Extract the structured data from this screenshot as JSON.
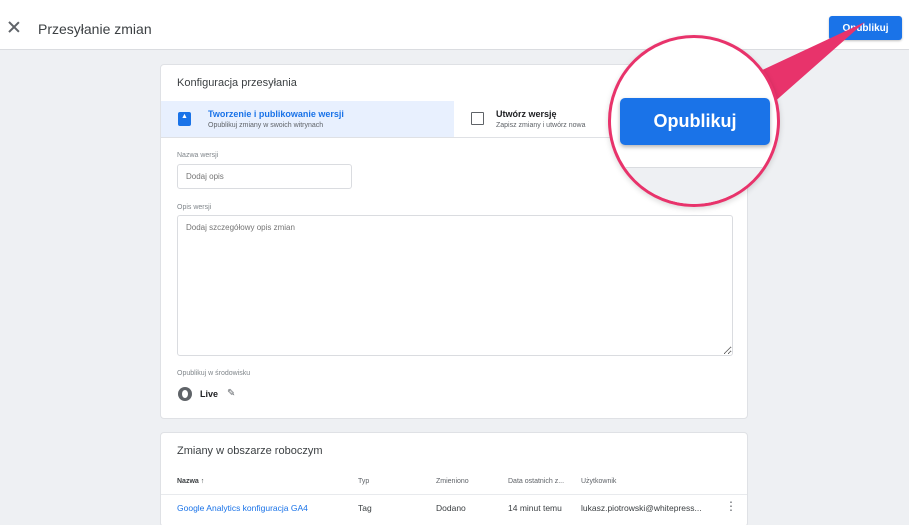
{
  "header": {
    "title": "Przesyłanie zmian",
    "publish_label": "Opublikuj"
  },
  "config": {
    "title": "Konfiguracja przesyłania",
    "option_publish": {
      "title": "Tworzenie i publikowanie wersji",
      "subtitle": "Opublikuj zmiany w swoich witrynach"
    },
    "option_version": {
      "title": "Utwórz wersję",
      "subtitle": "Zapisz zmiany i utwórz nowa"
    },
    "version_name": {
      "label": "Nazwa wersji",
      "placeholder": "Dodaj opis"
    },
    "version_description": {
      "label": "Opis wersji",
      "placeholder": "Dodaj szczegółowy opis zmian"
    },
    "environment": {
      "label": "Opublikuj w środowisku",
      "value": "Live"
    }
  },
  "changes": {
    "title": "Zmiany w obszarze roboczym",
    "columns": [
      "Nazwa",
      "Typ",
      "Zmieniono",
      "Data ostatnich z...",
      "Użytkownik"
    ],
    "sort_indicator": "↑",
    "rows": [
      {
        "name": "Google Analytics konfiguracja GA4",
        "type": "Tag",
        "change": "Dodano",
        "date": "14 minut temu",
        "user": "lukasz.piotrowski@whitepress..."
      }
    ]
  },
  "callout": {
    "button_label": "Opublikuj"
  },
  "colors": {
    "accent": "#1a73e8",
    "callout": "#e8336b"
  },
  "icons": [
    "close-icon",
    "publish-version-icon",
    "create-version-icon",
    "globe-icon",
    "pencil-icon",
    "sort-arrow-icon",
    "more-vert-icon"
  ]
}
